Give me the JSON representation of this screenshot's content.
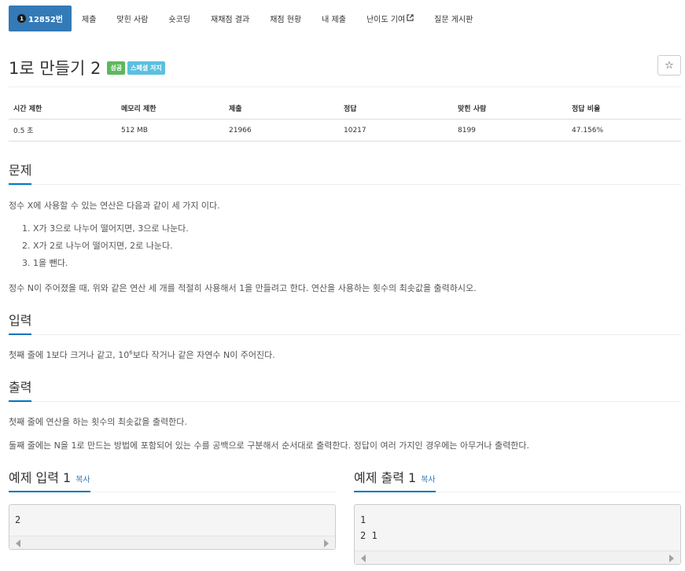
{
  "tabs": [
    {
      "label": "12852번",
      "badge": "1",
      "active": true
    },
    {
      "label": "제출"
    },
    {
      "label": "맞힌 사람"
    },
    {
      "label": "숏코딩"
    },
    {
      "label": "재채점 결과"
    },
    {
      "label": "채점 현황"
    },
    {
      "label": "내 제출"
    },
    {
      "label": "난이도 기여"
    },
    {
      "label": "질문 게시판"
    }
  ],
  "problem": {
    "title": "1로 만들기 2",
    "labels": [
      "성공",
      "스페셜 저지"
    ],
    "star_icon": "☆"
  },
  "stats": {
    "headers": [
      "시간 제한",
      "메모리 제한",
      "제출",
      "정답",
      "맞힌 사람",
      "정답 비율"
    ],
    "values": [
      "0.5 초",
      "512 MB",
      "21966",
      "10217",
      "8199",
      "47.156%"
    ]
  },
  "description": {
    "heading": "문제",
    "intro": "정수 X에 사용할 수 있는 연산은 다음과 같이 세 가지 이다.",
    "ops": [
      "1. X가 3으로 나누어 떨어지면, 3으로 나눈다.",
      "2. X가 2로 나누어 떨어지면, 2로 나눈다.",
      "3. 1을 뺀다."
    ],
    "body": "정수 N이 주어졌을 때, 위와 같은 연산 세 개를 적절히 사용해서 1을 만들려고 한다. 연산을 사용하는 횟수의 최솟값을 출력하시오."
  },
  "input": {
    "heading": "입력",
    "text_pre": "첫째 줄에 1보다 크거나 같고, 10",
    "text_sup": "6",
    "text_post": "보다 작거나 같은 자연수 N이 주어진다."
  },
  "output": {
    "heading": "출력",
    "line1": "첫째 줄에 연산을 하는 횟수의 최솟값을 출력한다.",
    "line2": "둘째 줄에는 N을 1로 만드는 방법에 포함되어 있는 수를 공백으로 구분해서 순서대로 출력한다. 정답이 여러 가지인 경우에는 아무거나 출력한다."
  },
  "sample_input": {
    "heading": "예제 입력 1",
    "copy": "복사",
    "content": "2"
  },
  "sample_output": {
    "heading": "예제 출력 1",
    "copy": "복사",
    "content": "1\n2 1"
  }
}
